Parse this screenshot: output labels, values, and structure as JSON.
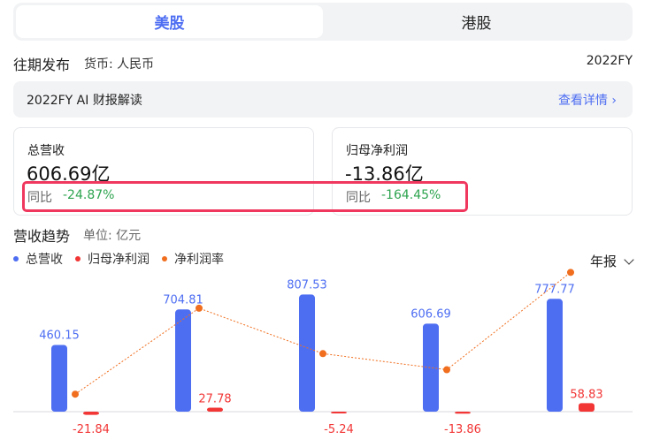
{
  "tabs": [
    {
      "label": "美股"
    },
    {
      "label": "港股"
    }
  ],
  "period": {
    "title": "往期发布",
    "currency": "货币: 人民币",
    "fiscal_year": "2022FY"
  },
  "ai_summary": {
    "title": "2022FY AI 财报解读",
    "link": "查看详情 ›"
  },
  "cards": [
    {
      "label": "总营收",
      "value": "606.69亿",
      "yoy_label": "同比",
      "yoy": "-24.87%"
    },
    {
      "label": "归母净利润",
      "value": "-13.86亿",
      "yoy_label": "同比",
      "yoy": "-164.45%"
    }
  ],
  "trend": {
    "title": "营收趋势",
    "unit": "单位: 亿元",
    "period_select": "年报"
  },
  "legend": [
    {
      "name": "总营收",
      "color": "#4e6ef2"
    },
    {
      "name": "归母净利润",
      "color": "#f23535"
    },
    {
      "name": "净利润率",
      "color": "#f06e1e"
    }
  ],
  "chart_data": {
    "type": "bar",
    "categories": [
      "",
      "",
      "",
      "",
      ""
    ],
    "series": [
      {
        "name": "总营收",
        "values": [
          460.15,
          704.81,
          807.53,
          606.69,
          777.77
        ],
        "color": "#4e6ef2"
      },
      {
        "name": "归母净利润",
        "values": [
          -21.84,
          27.78,
          -5.24,
          -13.86,
          58.83
        ],
        "color": "#f23535"
      },
      {
        "name": "净利润率",
        "values": [
          -4.75,
          3.94,
          -0.65,
          -2.28,
          7.56
        ],
        "color": "#f06e1e",
        "type": "line"
      }
    ],
    "value_labels": {
      "revenue": [
        "460.15",
        "704.81",
        "807.53",
        "606.69",
        "777.77"
      ],
      "net_profit": [
        "-21.84",
        "27.78",
        "-5.24",
        "-13.86",
        "58.83"
      ]
    }
  }
}
